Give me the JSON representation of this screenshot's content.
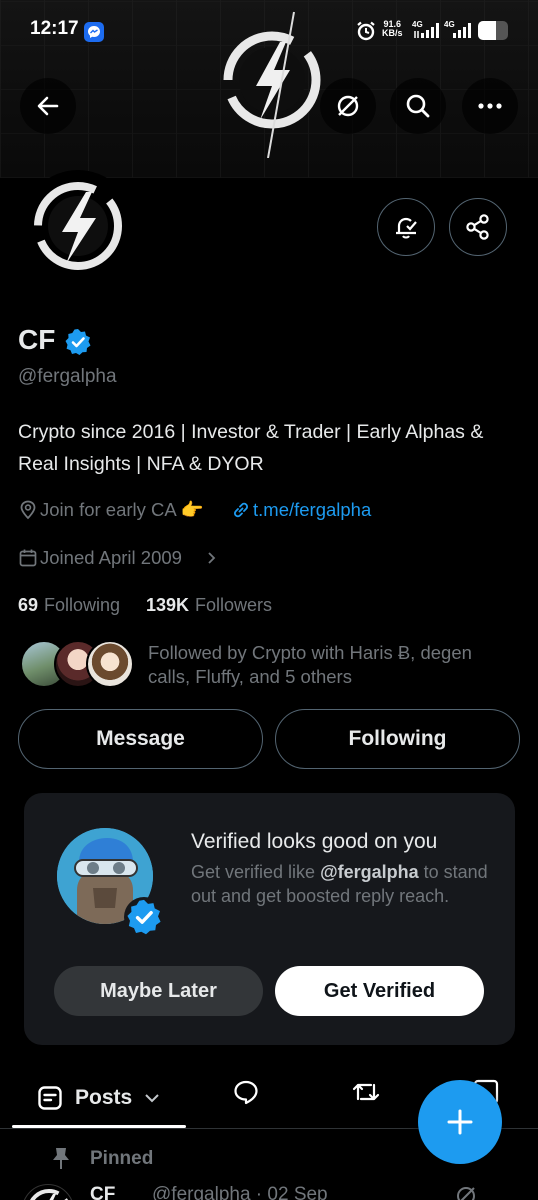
{
  "status_bar": {
    "time": "12:17",
    "net_speed": "91.6",
    "net_unit": "KB/s",
    "net_type_1": "4G",
    "net_type_2": "4G"
  },
  "profile": {
    "name": "CF",
    "handle": "@fergalpha",
    "bio": "Crypto since 2016 | Investor & Trader | Early Alphas & Real Insights | NFA & DYOR",
    "location": "Join for early CA 👉",
    "website": "t.me/fergalpha",
    "joined": "Joined April 2009",
    "following_count": "69",
    "following_label": "Following",
    "followers_count": "139K",
    "followers_label": "Followers",
    "followed_by": "Followed by Crypto with Haris Ƀ, degen calls, Fluffy, and 5 others"
  },
  "actions": {
    "message": "Message",
    "following": "Following"
  },
  "promo": {
    "title": "Verified looks good on you",
    "desc_prefix": "Get verified like ",
    "desc_handle": "@fergalpha",
    "desc_suffix": " to stand out and get boosted reply reach.",
    "maybe_later": "Maybe Later",
    "get_verified": "Get Verified"
  },
  "tabs": {
    "posts": "Posts"
  },
  "pinned": {
    "label": "Pinned",
    "author": "CF",
    "meta": "@fergalpha · 02 Sep"
  },
  "colors": {
    "accent": "#1d9bf0",
    "background": "#000000",
    "muted": "#71767b"
  }
}
